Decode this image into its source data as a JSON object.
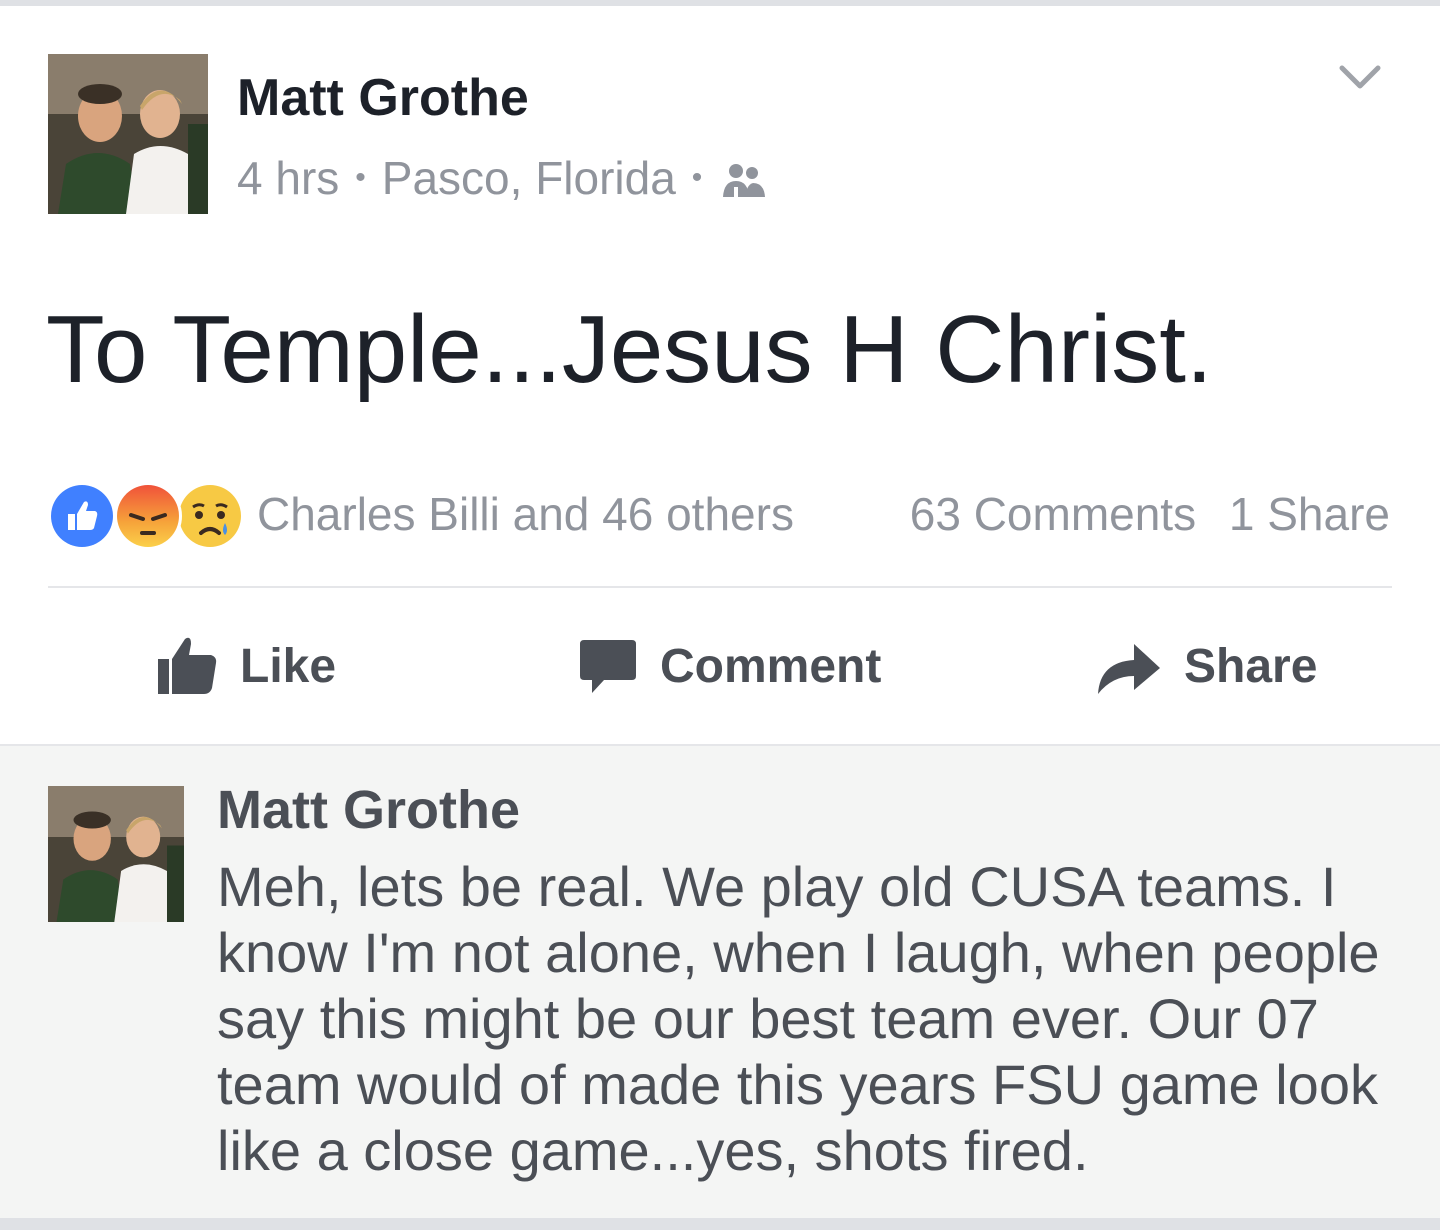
{
  "post": {
    "author": "Matt Grothe",
    "time": "4 hrs",
    "separator": "•",
    "location": "Pasco, Florida",
    "audience_icon": "friends-icon",
    "menu_icon": "chevron-down-icon",
    "text": "To Temple...Jesus H Christ."
  },
  "reactions": {
    "icons": [
      "like-reaction-icon",
      "angry-reaction-icon",
      "sad-reaction-icon"
    ],
    "summary": "Charles Billi and 46 others",
    "comments": "63 Comments",
    "shares": "1 Share"
  },
  "actions": {
    "like": "Like",
    "comment": "Comment",
    "share": "Share"
  },
  "comment": {
    "author": "Matt Grothe",
    "text": "Meh, lets be real. We play old CUSA teams. I know I'm not alone, when I laugh, when people say this might be our best team ever. Our 07 team would of made this years FSU game look like a close game...yes, shots fired."
  },
  "colors": {
    "primary_text": "#1d2129",
    "secondary_text": "#90949c",
    "action_text": "#4b4f56",
    "like_blue": "#4080ff",
    "comment_bg": "#f4f5f4"
  }
}
